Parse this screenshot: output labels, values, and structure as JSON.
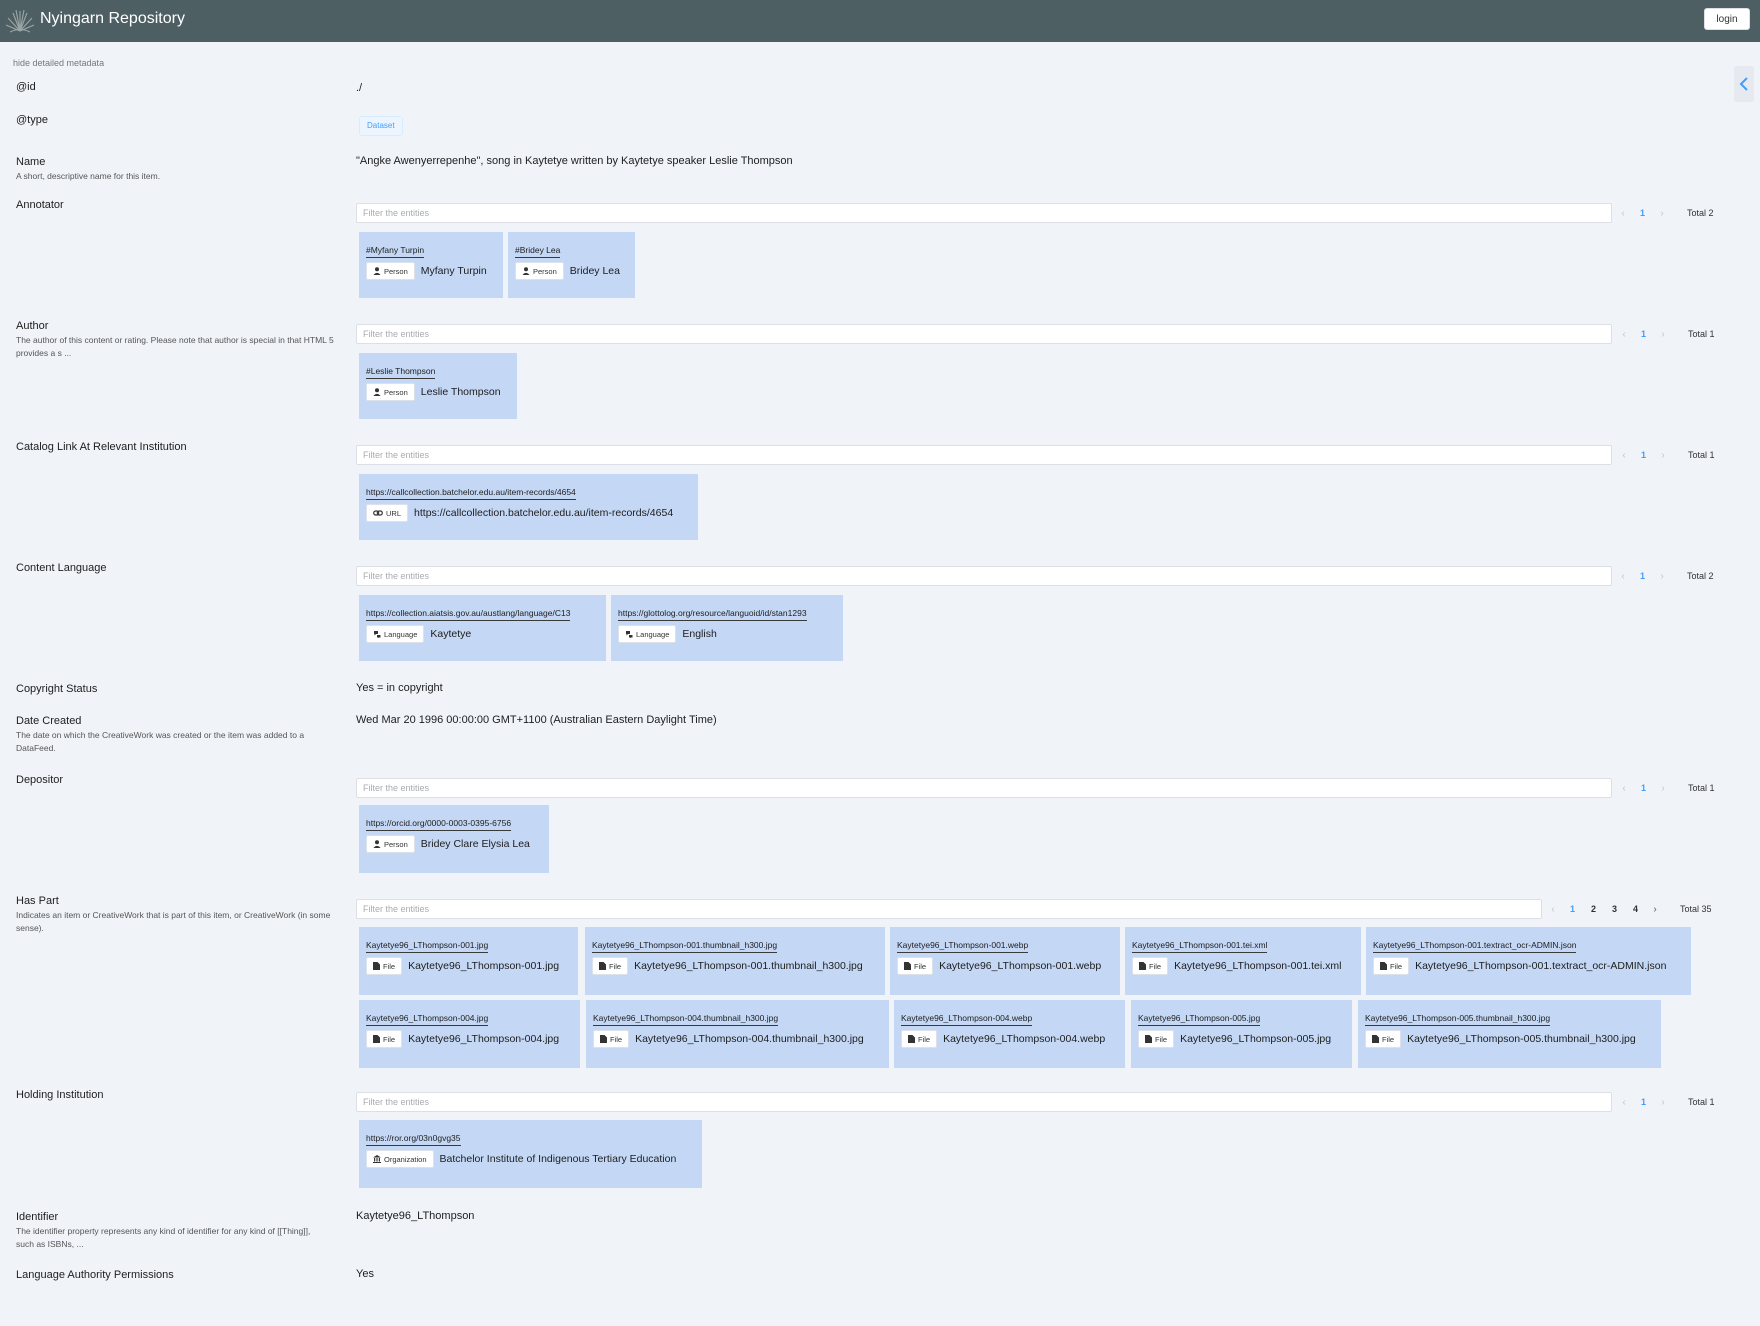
{
  "header": {
    "title": "Nyingarn Repository",
    "login_label": "login"
  },
  "hide_label": "hide detailed metadata",
  "filter_placeholder": "Filter the entities",
  "rows": {
    "id": {
      "label": "@id",
      "value": "./"
    },
    "type": {
      "label": "@type",
      "tag": "Dataset"
    },
    "name": {
      "label": "Name",
      "desc": "A short, descriptive name for this item.",
      "value": "\"Angke Awenyerrepenhe\", song in Kaytetye written by Kaytetye speaker Leslie Thompson"
    },
    "annotator": {
      "label": "Annotator",
      "page": "1",
      "total": "Total 2",
      "entities": [
        {
          "id": "#Myfany Turpin",
          "type": "Person",
          "name": "Myfany Turpin"
        },
        {
          "id": "#Bridey Lea",
          "type": "Person",
          "name": "Bridey Lea"
        }
      ]
    },
    "author": {
      "label": "Author",
      "desc": "The author of this content or rating. Please note that author is special in that HTML 5 provides a s ...",
      "page": "1",
      "total": "Total 1",
      "entities": [
        {
          "id": "#Leslie Thompson",
          "type": "Person",
          "name": "Leslie Thompson"
        }
      ]
    },
    "catalog": {
      "label": "Catalog Link At Relevant Institution",
      "page": "1",
      "total": "Total 1",
      "entities": [
        {
          "id": "https://callcollection.batchelor.edu.au/item-records/4654",
          "type": "URL",
          "name": "https://callcollection.batchelor.edu.au/item-records/4654"
        }
      ]
    },
    "language": {
      "label": "Content Language",
      "page": "1",
      "total": "Total 2",
      "entities": [
        {
          "id": "https://collection.aiatsis.gov.au/austlang/language/C13",
          "type": "Language",
          "name": "Kaytetye"
        },
        {
          "id": "https://glottolog.org/resource/languoid/id/stan1293",
          "type": "Language",
          "name": "English"
        }
      ]
    },
    "copyright": {
      "label": "Copyright Status",
      "value": "Yes = in copyright"
    },
    "date": {
      "label": "Date Created",
      "desc": "The date on which the CreativeWork was created or the item was added to a DataFeed.",
      "value": "Wed Mar 20 1996 00:00:00 GMT+1100 (Australian Eastern Daylight Time)"
    },
    "depositor": {
      "label": "Depositor",
      "page": "1",
      "total": "Total 1",
      "entities": [
        {
          "id": "https://orcid.org/0000-0003-0395-6756",
          "type": "Person",
          "name": "Bridey Clare Elysia Lea"
        }
      ]
    },
    "haspart": {
      "label": "Has Part",
      "desc": "Indicates an item or CreativeWork that is part of this item, or CreativeWork (in some sense).",
      "pages": [
        "1",
        "2",
        "3",
        "4"
      ],
      "total": "Total 35",
      "entities": [
        {
          "id": "Kaytetye96_LThompson-001.jpg",
          "type": "File",
          "name": "Kaytetye96_LThompson-001.jpg"
        },
        {
          "id": "Kaytetye96_LThompson-001.thumbnail_h300.jpg",
          "type": "File",
          "name": "Kaytetye96_LThompson-001.thumbnail_h300.jpg"
        },
        {
          "id": "Kaytetye96_LThompson-001.webp",
          "type": "File",
          "name": "Kaytetye96_LThompson-001.webp"
        },
        {
          "id": "Kaytetye96_LThompson-001.tei.xml",
          "type": "File",
          "name": "Kaytetye96_LThompson-001.tei.xml"
        },
        {
          "id": "Kaytetye96_LThompson-001.textract_ocr-ADMIN.json",
          "type": "File",
          "name": "Kaytetye96_LThompson-001.textract_ocr-ADMIN.json"
        },
        {
          "id": "Kaytetye96_LThompson-004.jpg",
          "type": "File",
          "name": "Kaytetye96_LThompson-004.jpg"
        },
        {
          "id": "Kaytetye96_LThompson-004.thumbnail_h300.jpg",
          "type": "File",
          "name": "Kaytetye96_LThompson-004.thumbnail_h300.jpg"
        },
        {
          "id": "Kaytetye96_LThompson-004.webp",
          "type": "File",
          "name": "Kaytetye96_LThompson-004.webp"
        },
        {
          "id": "Kaytetye96_LThompson-005.jpg",
          "type": "File",
          "name": "Kaytetye96_LThompson-005.jpg"
        },
        {
          "id": "Kaytetye96_LThompson-005.thumbnail_h300.jpg",
          "type": "File",
          "name": "Kaytetye96_LThompson-005.thumbnail_h300.jpg"
        }
      ]
    },
    "holding": {
      "label": "Holding Institution",
      "page": "1",
      "total": "Total 1",
      "entities": [
        {
          "id": "https://ror.org/03n0gvg35",
          "type": "Organization",
          "name": "Batchelor Institute of Indigenous Tertiary Education"
        }
      ]
    },
    "identifier": {
      "label": "Identifier",
      "desc": "The identifier property represents any kind of identifier for any kind of [[Thing]], such as ISBNs, ...",
      "value": "Kaytetye96_LThompson"
    },
    "permissions": {
      "label": "Language Authority Permissions",
      "value": "Yes"
    }
  }
}
